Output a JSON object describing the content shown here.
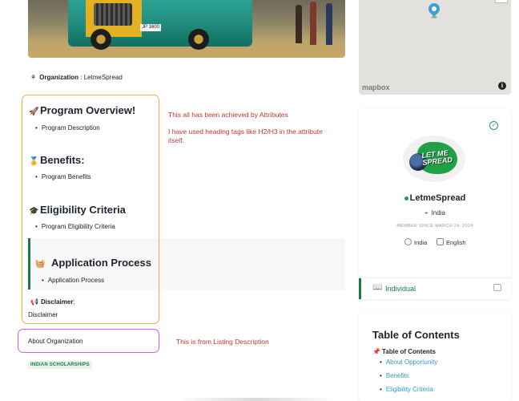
{
  "hero": {
    "plate": "JP 1600",
    "colors": {
      "bus_body": "#1f8a7c",
      "bus_front": "#e3b021"
    }
  },
  "map": {
    "attribution": "mapbox",
    "info_glyph": "i",
    "pin_color": "#3aa3d0"
  },
  "organization": {
    "label": "Organization",
    "separator": " : ",
    "value": "LetmeSpread"
  },
  "sections": [
    {
      "title": "Program Overview!",
      "icon": "rocket-icon",
      "glyph": "🚀",
      "item": "Program Description"
    },
    {
      "title": "Benefits:",
      "icon": "award-icon",
      "glyph": "🏅",
      "item": "Program Benefits"
    },
    {
      "title": "Eligibility Criteria",
      "icon": "graduation-cap-icon",
      "glyph": "🎓",
      "item": "Program Eligibility Criteria"
    },
    {
      "title": "Application Process",
      "icon": "basket-icon",
      "glyph": "🧺",
      "item": "Application Process"
    }
  ],
  "disclaimer": {
    "label": "Disclaimer",
    "suffix": ":",
    "text": "Disclaimer",
    "glyph": "📢"
  },
  "about": {
    "text": "About Organization"
  },
  "tag": {
    "text": "INDIAN SCHOLARSHIPS"
  },
  "notes": {
    "attributes_line1": "This all has been achieved by Attributes",
    "attributes_line2": "I have used heading tags like H2/H3 in the attribute itself.",
    "listing": "This is from Listing Description"
  },
  "profile": {
    "verified_glyph": "✓",
    "logo_text_line1": "LET ME",
    "logo_text_line2": "SPREAD",
    "name": "LetmeSpread",
    "location": "India",
    "member_since": "MEMBER SINCE MARCH 24, 2024",
    "country": "India",
    "language": "English",
    "footer_label": "Individual",
    "footer_glyph": "📖"
  },
  "toc": {
    "title": "Table of Contents",
    "subtitle": "Table of Contents",
    "pin": "📌",
    "links": [
      "About Opportunity",
      "Benefits",
      "Eligibility Criteria"
    ]
  },
  "colors": {
    "accent": "#1b7a45",
    "note": "#c0392b",
    "link": "#2f9ccf",
    "orange_frame": "#f3b03e",
    "pink_frame": "#e05ad8"
  }
}
